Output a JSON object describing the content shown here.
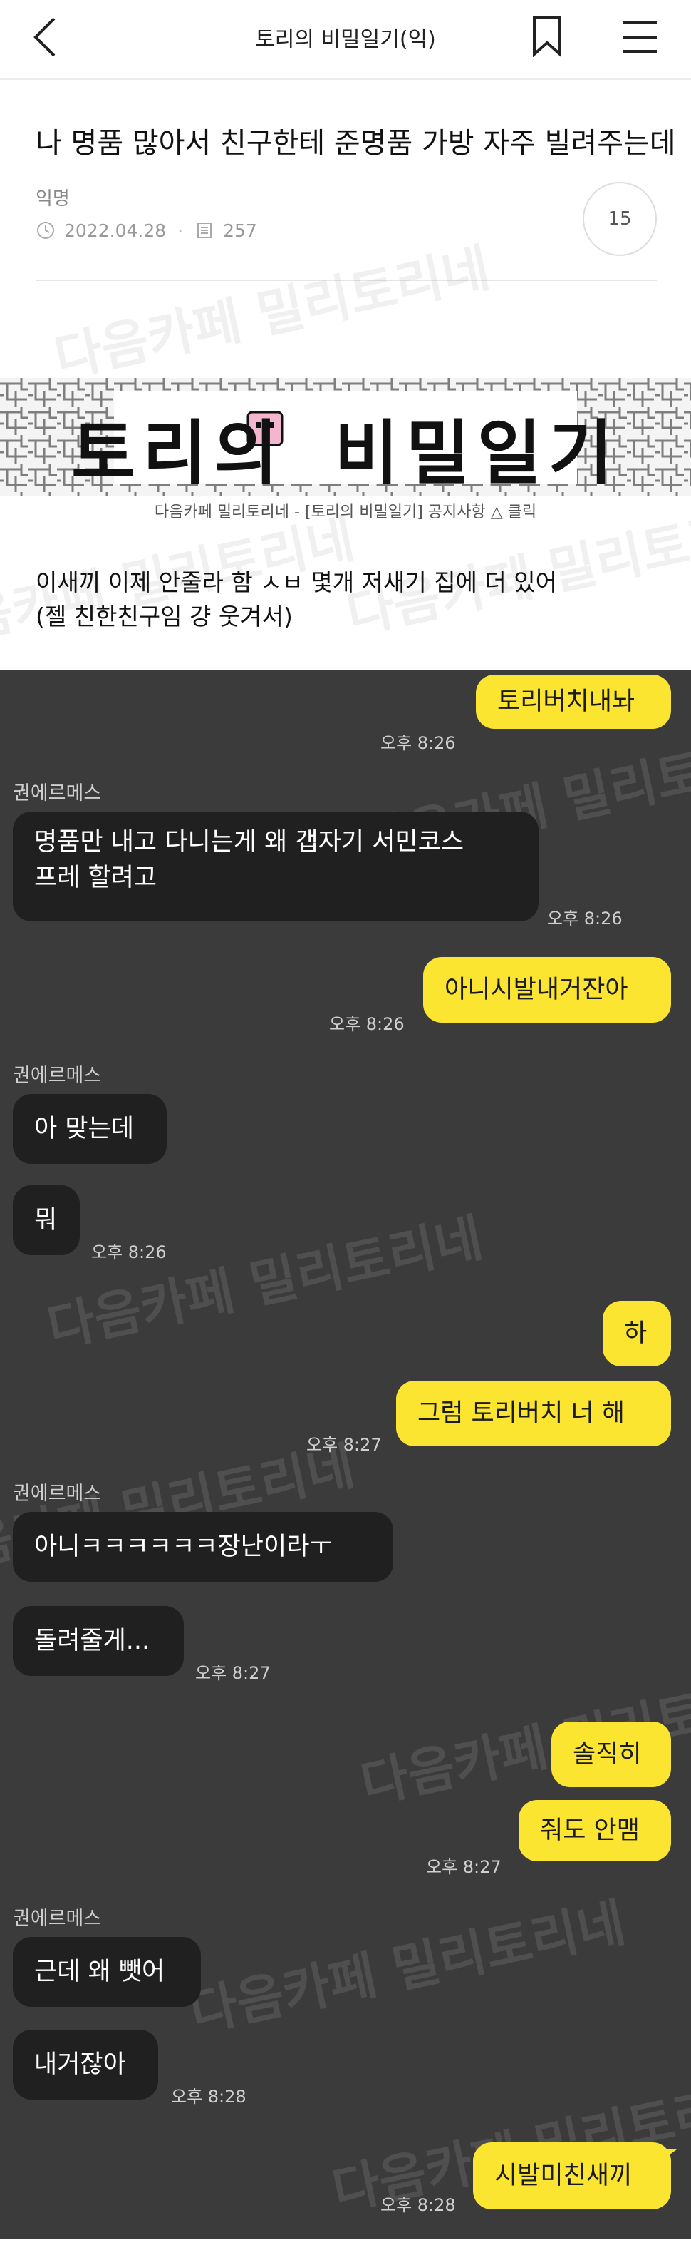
{
  "header": {
    "title": "토리의 비밀일기(익)"
  },
  "post": {
    "title": "나 명품 많아서 친구한테 준명품 가방 자주 빌려주는데",
    "author": "익명",
    "date": "2022.04.28",
    "views": "257",
    "comments": "15"
  },
  "banner": {
    "logo_text": "토리의 비밀일기",
    "caption": "다음카페 밀리토리네 - [토리의 비밀일기] 공지사항 △ 클릭"
  },
  "body": {
    "line1": "이새끼 이제 안줄라 함 ㅅㅂ 몇개 저새기 집에 더 있어",
    "line2": "(젤 친한친구임 걍 웃겨서)"
  },
  "watermark": "다음카페 밀리토리네",
  "chat": {
    "sender": "권에르메스",
    "messages": [
      {
        "text": "토리버치내놔",
        "time": "오후 8:26"
      },
      {
        "text": "명품만 내고 다니는게 왜 갭자기 서민코스 프레 할려고",
        "line1": "명품만 내고 다니는게 왜 갭자기 서민코스",
        "line2": "프레 할려고",
        "time": "오후 8:26"
      },
      {
        "text": "아니시발내거잔아",
        "time": "오후 8:26"
      },
      {
        "text": "아 맞는데"
      },
      {
        "text": "뭐",
        "time": "오후 8:26"
      },
      {
        "text": "하"
      },
      {
        "text": "그럼 토리버치 너 해",
        "time": "오후 8:27"
      },
      {
        "text": "아니ㅋㅋㅋㅋㅋㅋ장난이라ㅜ"
      },
      {
        "text": "돌려줄게...",
        "time": "오후 8:27"
      },
      {
        "text": "솔직히"
      },
      {
        "text": "줘도 안맴",
        "time": "오후 8:27"
      },
      {
        "text": "근데 왜 뺏어"
      },
      {
        "text": "내거잖아",
        "time": "오후 8:28"
      },
      {
        "text": "시발미친새끼",
        "time": "오후 8:28"
      }
    ]
  }
}
